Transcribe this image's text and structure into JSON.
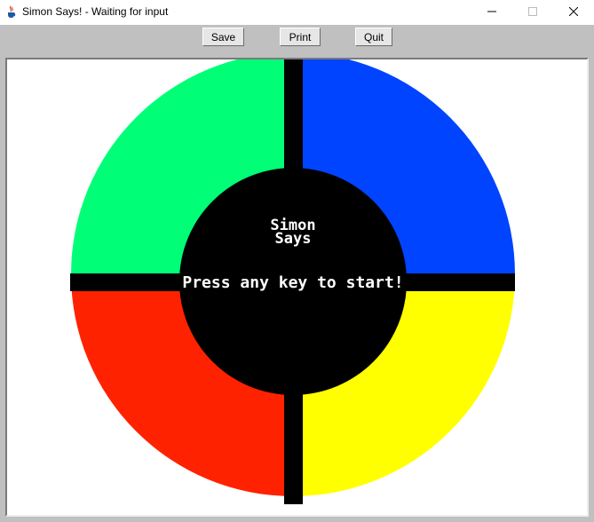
{
  "window": {
    "title": "Simon Says! - Waiting for input"
  },
  "toolbar": {
    "save_label": "Save",
    "print_label": "Print",
    "quit_label": "Quit"
  },
  "game": {
    "title_line1": "Simon",
    "title_line2": "Says",
    "prompt": "Press any key to start!",
    "colors": {
      "top_left": "#00ff77",
      "top_right": "#0044ff",
      "bottom_left": "#ff2200",
      "bottom_right": "#ffff00",
      "center": "#000000"
    }
  },
  "icons": {
    "app": "java-cup-icon",
    "minimize": "minimize-icon",
    "maximize": "maximize-icon",
    "close": "close-icon"
  }
}
